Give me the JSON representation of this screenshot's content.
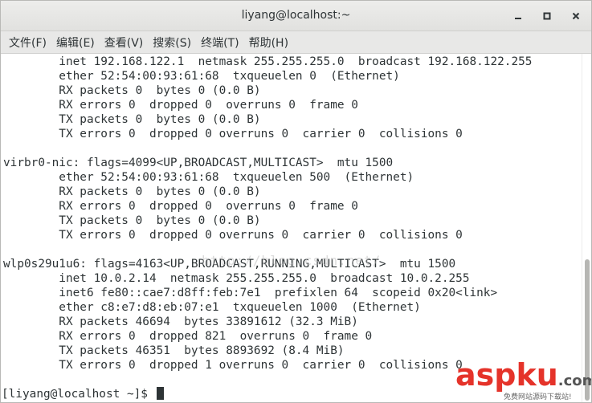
{
  "window": {
    "title": "liyang@localhost:~",
    "minimize_glyph": "minimize-icon",
    "maximize_glyph": "maximize-icon",
    "close_glyph": "close-icon"
  },
  "menu": {
    "items": [
      "文件(F)",
      "编辑(E)",
      "查看(V)",
      "搜索(S)",
      "终端(T)",
      "帮助(H)"
    ]
  },
  "terminal": {
    "lines": [
      "        inet 192.168.122.1  netmask 255.255.255.0  broadcast 192.168.122.255",
      "        ether 52:54:00:93:61:68  txqueuelen 0  (Ethernet)",
      "        RX packets 0  bytes 0 (0.0 B)",
      "        RX errors 0  dropped 0  overruns 0  frame 0",
      "        TX packets 0  bytes 0 (0.0 B)",
      "        TX errors 0  dropped 0 overruns 0  carrier 0  collisions 0",
      "",
      "virbr0-nic: flags=4099<UP,BROADCAST,MULTICAST>  mtu 1500",
      "        ether 52:54:00:93:61:68  txqueuelen 500  (Ethernet)",
      "        RX packets 0  bytes 0 (0.0 B)",
      "        RX errors 0  dropped 0  overruns 0  frame 0",
      "        TX packets 0  bytes 0 (0.0 B)",
      "        TX errors 0  dropped 0 overruns 0  carrier 0  collisions 0",
      "",
      "wlp0s29u1u6: flags=4163<UP,BROADCAST,RUNNING,MULTICAST>  mtu 1500",
      "        inet 10.0.2.14  netmask 255.255.255.0  broadcast 10.0.2.255",
      "        inet6 fe80::cae7:d8ff:feb:7e1  prefixlen 64  scopeid 0x20<link>",
      "        ether c8:e7:d8:eb:07:e1  txqueuelen 1000  (Ethernet)",
      "        RX packets 46694  bytes 33891612 (32.3 MiB)",
      "        RX errors 0  dropped 821  overruns 0  frame 0",
      "        TX packets 46351  bytes 8893692 (8.4 MiB)",
      "        TX errors 0  dropped 1 overruns 0  carrier 0  collisions 0"
    ],
    "prompt": "[liyang@localhost ~]$ "
  },
  "watermarks": {
    "blog_url": "http://blog.csdn.net/",
    "logo_asp": "asp",
    "logo_ku": "ku",
    "logo_com": ".com",
    "logo_sub": "免费网站源码下载站!"
  },
  "colors": {
    "text": "#2e3436",
    "background": "#ffffff",
    "chrome": "#e8e8e7",
    "logo_red": "#e5332a"
  }
}
